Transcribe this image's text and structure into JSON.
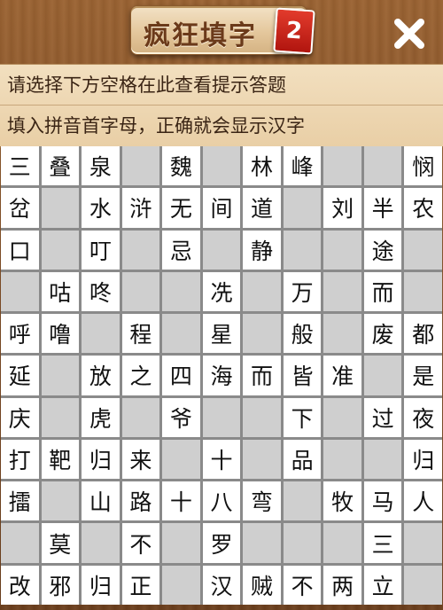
{
  "header": {
    "title": "疯狂填字",
    "level": "2",
    "close_icon": "close-icon"
  },
  "hints": {
    "line1": "请选择下方空格在此查看提示答题",
    "line2": "填入拼音首字母，正确就会显示汉字"
  },
  "colors": {
    "wood": "#8a5a2c",
    "white_cell": "#ffffff",
    "blocked_cell": "#cfcfcf",
    "badge_red": "#c8201a"
  },
  "grid": {
    "rows": [
      [
        "三",
        "叠",
        "泉",
        null,
        "魏",
        null,
        "林",
        "峰",
        null,
        null,
        "悯"
      ],
      [
        "岔",
        null,
        "水",
        "浒",
        "无",
        "间",
        "道",
        null,
        "刘",
        "半",
        "农"
      ],
      [
        "口",
        null,
        "叮",
        null,
        "忌",
        null,
        "静",
        null,
        null,
        "途",
        null
      ],
      [
        null,
        "咕",
        "咚",
        null,
        null,
        "冼",
        null,
        "万",
        null,
        "而",
        null
      ],
      [
        "呼",
        "噜",
        null,
        "程",
        null,
        "星",
        null,
        "般",
        null,
        "废",
        "都"
      ],
      [
        "延",
        null,
        "放",
        "之",
        "四",
        "海",
        "而",
        "皆",
        "准",
        null,
        "是"
      ],
      [
        "庆",
        null,
        "虎",
        null,
        "爷",
        null,
        null,
        "下",
        null,
        "过",
        "夜"
      ],
      [
        "打",
        "靶",
        "归",
        "来",
        null,
        "十",
        null,
        "品",
        null,
        null,
        "归"
      ],
      [
        "擂",
        null,
        "山",
        "路",
        "十",
        "八",
        "弯",
        null,
        "牧",
        "马",
        "人"
      ],
      [
        null,
        "莫",
        null,
        "不",
        null,
        "罗",
        null,
        null,
        null,
        "三",
        null
      ],
      [
        "改",
        "邪",
        "归",
        "正",
        null,
        "汉",
        "贼",
        "不",
        "两",
        "立",
        null
      ]
    ]
  }
}
